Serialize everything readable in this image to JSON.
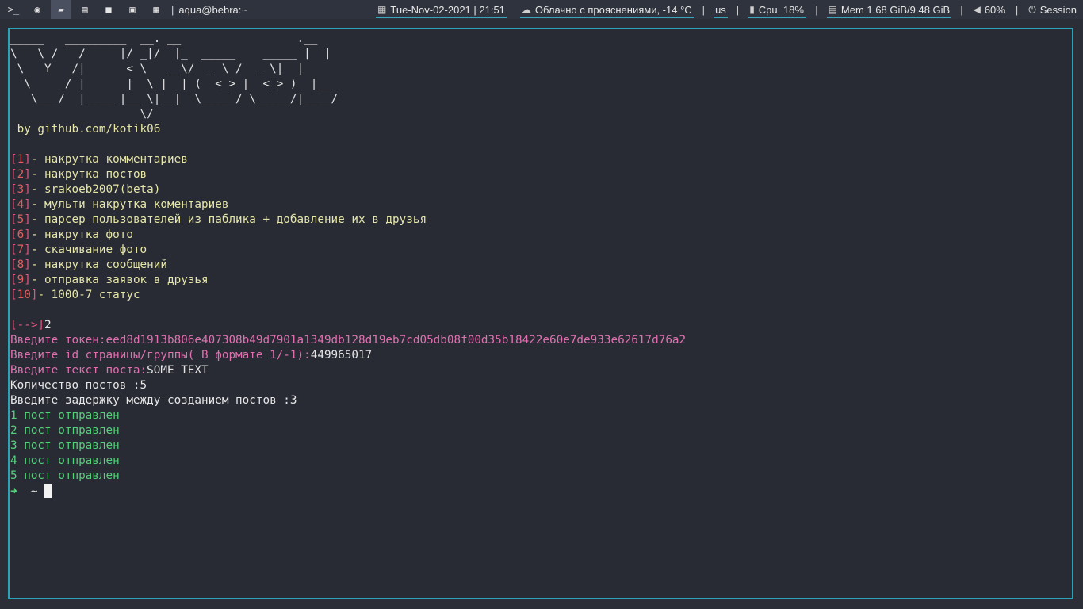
{
  "panel": {
    "launchers": [
      {
        "name": "terminal-launcher-icon",
        "glyph": ">_"
      },
      {
        "name": "firefox-launcher-icon",
        "glyph": "◉"
      },
      {
        "name": "file-manager-launcher-icon",
        "glyph": "▰"
      },
      {
        "name": "text-editor-launcher-icon",
        "glyph": "▤"
      },
      {
        "name": "video-launcher-icon",
        "glyph": "■"
      },
      {
        "name": "image-viewer-launcher-icon",
        "glyph": "▣"
      },
      {
        "name": "apps-grid-launcher-icon",
        "glyph": "▦"
      }
    ],
    "window_title": "aqua@bebra:~",
    "datetime": "Tue-Nov-02-2021 | 21:51",
    "weather": "Облачно с прояснениями, -14 °C",
    "keyboard_layout": "us",
    "cpu": "Cpu  18%",
    "mem": "Mem 1.68 GiB/9.48 GiB",
    "volume": "60%",
    "session": "Session",
    "separator": "|"
  },
  "terminal": {
    "art": [
      "_____   _________  __. __                 .__",
      "\\   \\ /   /     |/ _|/  |_  _____    _____ |  |",
      " \\   Y   /|      < \\   __\\/  _ \\ /  _ \\|  |",
      "  \\     / |      |  \\ |  | (  <_> |  <_> )  |__",
      "   \\___/  |_____|__ \\|__|  \\_____/ \\_____/|____/",
      "                   \\/"
    ],
    "byline": " by github.com/kotik06",
    "menu": [
      {
        "num": "1",
        "text": "- накрутка комментариев"
      },
      {
        "num": "2",
        "text": "- накрутка постов"
      },
      {
        "num": "3",
        "text": "- srakoeb2007(beta)"
      },
      {
        "num": "4",
        "text": "- мульти накрутка коментариев"
      },
      {
        "num": "5",
        "text": "- парсер пользователей из паблика + добавление их в друзья"
      },
      {
        "num": "6",
        "text": "- накрутка фото"
      },
      {
        "num": "7",
        "text": "- скачивание фото"
      },
      {
        "num": "8",
        "text": "- накрутка сообщений"
      },
      {
        "num": "9",
        "text": "- отправка заявок в друзья"
      },
      {
        "num": "10",
        "text": "- 1000-7 статус"
      }
    ],
    "prompt_marker": "[-->]",
    "choice": "2",
    "token_label": "Введите токен:",
    "token_value": "eed8d1913b806e407308b49d7901a1349db128d19eb7cd05db08f00d35b18422e60e7de933e62617d76a2",
    "id_label": "Введите id страницы/группы( В формате 1/-1):",
    "id_value": "449965017",
    "text_label": "Введите текст поста:",
    "text_value": "SOME TEXT",
    "count_line": "Количество постов :5",
    "delay_line": "Введите задержку между созданием постов :3",
    "sent": [
      "1 пост отправлен",
      "2 пост отправлен",
      "3 пост отправлен",
      "4 пост отправлен",
      "5 пост отправлен"
    ],
    "shell_arrow": "➜",
    "shell_dir": "~"
  }
}
